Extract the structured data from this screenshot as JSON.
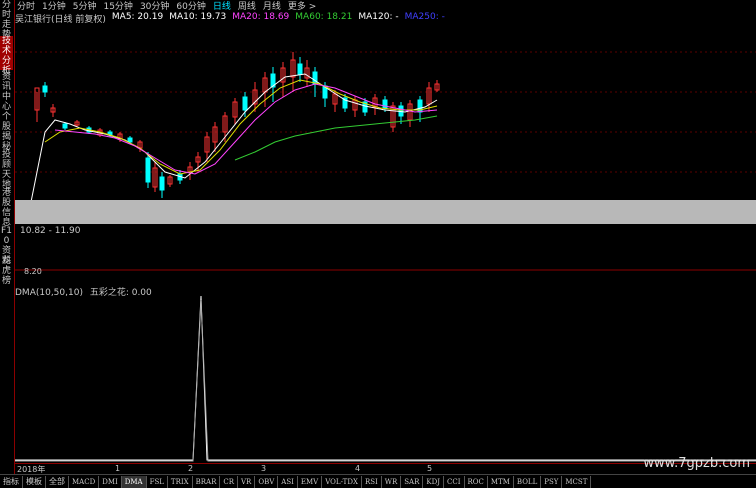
{
  "sidebar": {
    "items": [
      {
        "label": "分时走势",
        "active": false
      },
      {
        "label": "技术分析",
        "active": true
      },
      {
        "label": "资讯中心",
        "active": false
      },
      {
        "label": "个股揭秘",
        "active": false
      },
      {
        "label": "投顾天地",
        "active": false
      },
      {
        "label": "港股信息",
        "active": false
      },
      {
        "label": "F10资料",
        "active": false
      },
      {
        "label": "龙虎榜",
        "active": false
      }
    ]
  },
  "periods": [
    {
      "label": "分时",
      "active": false
    },
    {
      "label": "1分钟",
      "active": false
    },
    {
      "label": "5分钟",
      "active": false
    },
    {
      "label": "15分钟",
      "active": false
    },
    {
      "label": "30分钟",
      "active": false
    },
    {
      "label": "60分钟",
      "active": false
    },
    {
      "label": "日线",
      "active": true
    },
    {
      "label": "周线",
      "active": false
    },
    {
      "label": "月线",
      "active": false
    },
    {
      "label": "更多 >",
      "active": false
    }
  ],
  "ma": {
    "stock": "吴江银行(日线 前复权)",
    "items": [
      {
        "label": "MA5: 20.19",
        "color": "#ffffff"
      },
      {
        "label": "MA10: 19.73",
        "color": "#ffffff"
      },
      {
        "label": "MA20: 18.69",
        "color": "#ff44ff"
      },
      {
        "label": "MA60: 18.21",
        "color": "#33cc33"
      },
      {
        "label": "MA120: -",
        "color": "#ffffff"
      },
      {
        "label": "MA250: -",
        "color": "#4040ff"
      }
    ]
  },
  "price_range": "10.82 - 11.90",
  "volume_label": "8.20",
  "dma": {
    "label": "DMA(10,50,10)",
    "indicator": "五彩之花: 0.00"
  },
  "xaxis": {
    "ticks": [
      "2018年",
      "1",
      "2",
      "3",
      "4",
      "5"
    ]
  },
  "tabs": [
    {
      "label": "指标",
      "serif": false,
      "active": false
    },
    {
      "label": "模板",
      "serif": false,
      "active": false
    },
    {
      "label": "全部",
      "serif": false,
      "active": false
    },
    {
      "label": "MACD",
      "serif": true,
      "active": false
    },
    {
      "label": "DMI",
      "serif": true,
      "active": false
    },
    {
      "label": "DMA",
      "serif": true,
      "active": true
    },
    {
      "label": "FSL",
      "serif": true,
      "active": false
    },
    {
      "label": "TRIX",
      "serif": true,
      "active": false
    },
    {
      "label": "BRAR",
      "serif": true,
      "active": false
    },
    {
      "label": "CR",
      "serif": true,
      "active": false
    },
    {
      "label": "VR",
      "serif": true,
      "active": false
    },
    {
      "label": "OBV",
      "serif": true,
      "active": false
    },
    {
      "label": "ASI",
      "serif": true,
      "active": false
    },
    {
      "label": "EMV",
      "serif": true,
      "active": false
    },
    {
      "label": "VOL-TDX",
      "serif": true,
      "active": false
    },
    {
      "label": "RSI",
      "serif": true,
      "active": false
    },
    {
      "label": "WR",
      "serif": true,
      "active": false
    },
    {
      "label": "SAR",
      "serif": true,
      "active": false
    },
    {
      "label": "KDJ",
      "serif": true,
      "active": false
    },
    {
      "label": "CCI",
      "serif": true,
      "active": false
    },
    {
      "label": "ROC",
      "serif": true,
      "active": false
    },
    {
      "label": "MTM",
      "serif": true,
      "active": false
    },
    {
      "label": "BOLL",
      "serif": true,
      "active": false
    },
    {
      "label": "PSY",
      "serif": true,
      "active": false
    },
    {
      "label": "MCST",
      "serif": true,
      "active": false
    }
  ],
  "watermark": "www.7gpzb.com",
  "colors": {
    "up": "#ff3333",
    "down": "#00ffff",
    "grid": "#8b0000"
  }
}
